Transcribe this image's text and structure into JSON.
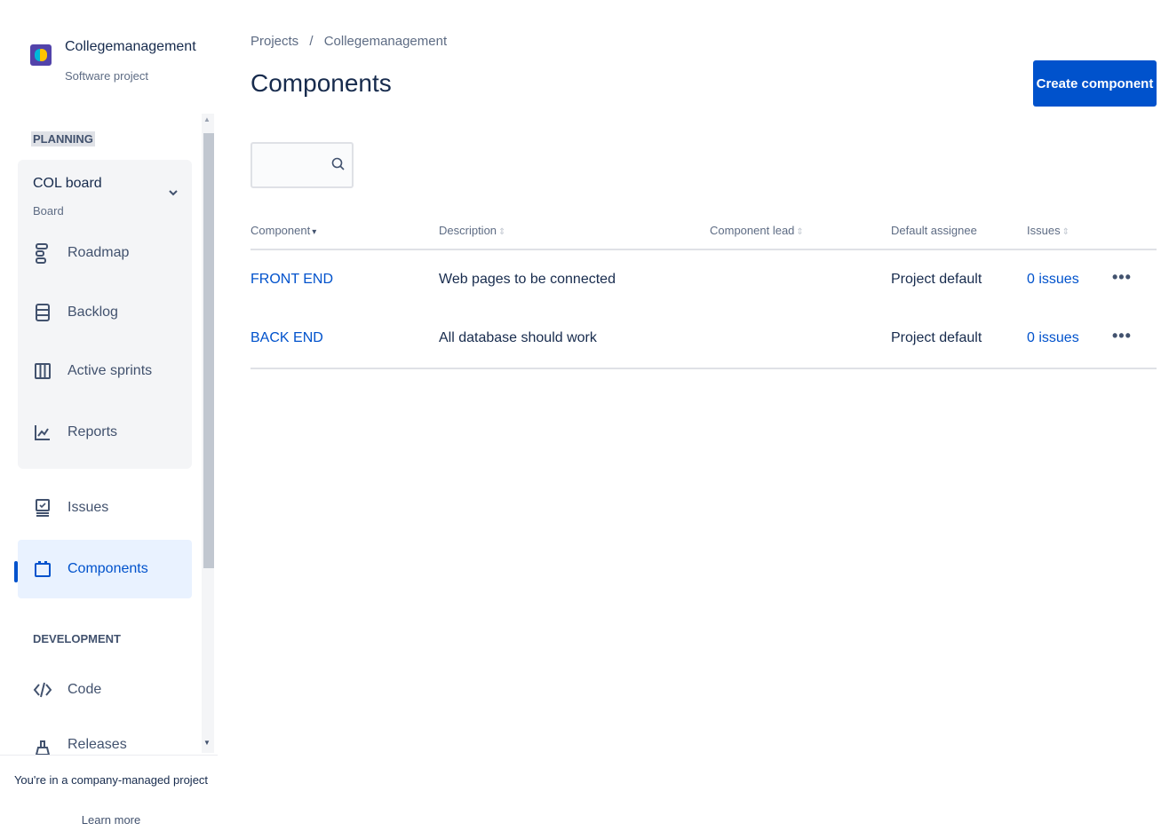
{
  "sidebar": {
    "project": {
      "name": "Collegemanagement",
      "type": "Software project"
    },
    "sections": {
      "planning": "PLANNING",
      "development": "DEVELOPMENT"
    },
    "board": {
      "title": "COL board",
      "subtitle": "Board"
    },
    "board_items": [
      {
        "label": "Roadmap",
        "icon": "roadmap-icon"
      },
      {
        "label": "Backlog",
        "icon": "backlog-icon"
      },
      {
        "label": "Active sprints",
        "icon": "active-sprints-icon"
      },
      {
        "label": "Reports",
        "icon": "reports-icon"
      }
    ],
    "items": [
      {
        "label": "Issues",
        "icon": "issues-icon"
      },
      {
        "label": "Components",
        "icon": "components-icon",
        "active": true
      }
    ],
    "dev_items": [
      {
        "label": "Code",
        "icon": "code-icon"
      },
      {
        "label": "Releases",
        "icon": "releases-icon"
      }
    ],
    "footer": {
      "text": "You're in a company-managed project",
      "link": "Learn more"
    }
  },
  "main": {
    "breadcrumb": {
      "root": "Projects",
      "separator": "/",
      "current": "Collegemanagement"
    },
    "title": "Components",
    "create_button": "Create component",
    "search": {
      "placeholder": "",
      "value": ""
    },
    "table": {
      "columns": [
        "Component",
        "Description",
        "Component lead",
        "Default assignee",
        "Issues"
      ],
      "rows": [
        {
          "component": "FRONT END",
          "description": "Web pages to be connected",
          "lead": "",
          "assignee": "Project default",
          "issues": "0 issues"
        },
        {
          "component": "BACK END",
          "description": "All database should work",
          "lead": "",
          "assignee": "Project default",
          "issues": "0 issues"
        }
      ],
      "more_label": "•••"
    }
  },
  "colors": {
    "accent": "#0052cc",
    "text": "#172b4d",
    "muted": "#5e6c84"
  }
}
